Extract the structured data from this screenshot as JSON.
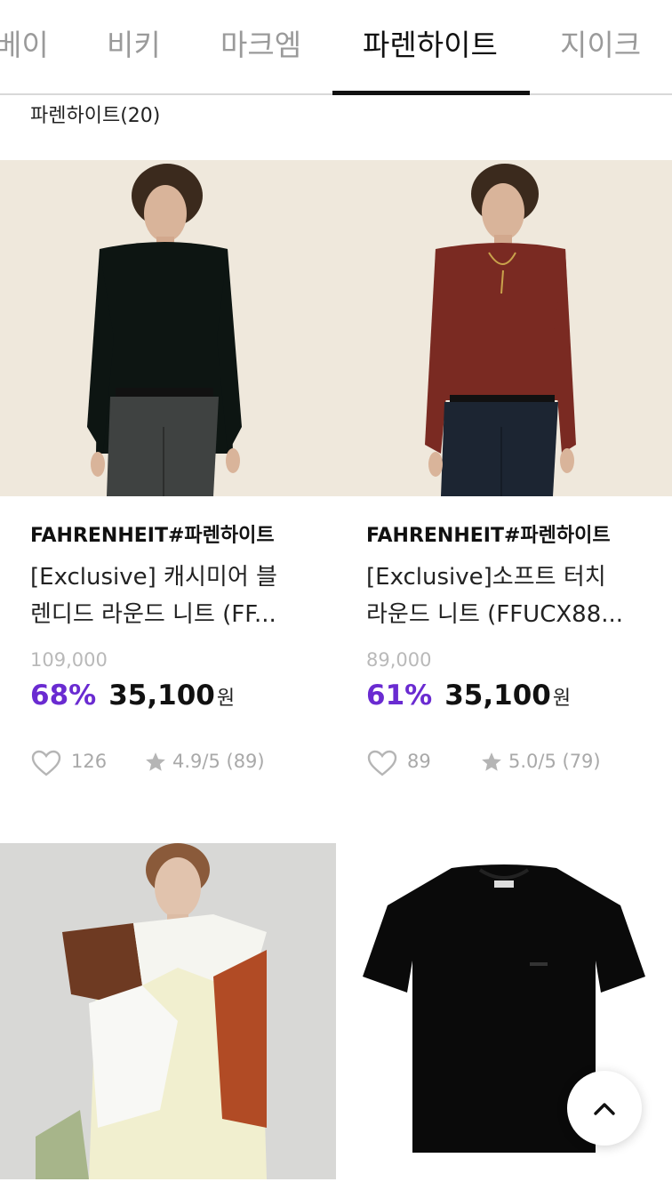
{
  "tabs": [
    {
      "label": "베이",
      "active": false
    },
    {
      "label": "비키",
      "active": false
    },
    {
      "label": "마크엠",
      "active": false
    },
    {
      "label": "파렌하이트",
      "active": true
    },
    {
      "label": "지이크",
      "active": false
    }
  ],
  "category_count_label": "파렌하이트(20)",
  "products": [
    {
      "brand": "FAHRENHEIT#파렌하이트",
      "name_line1": "[Exclusive] 캐시미어 블",
      "name_line2": "렌디드 라운드 니트 (FF...",
      "original_price": "109,000",
      "discount": "68%",
      "price": "35,100",
      "currency": "원",
      "likes": "126",
      "rating": "4.9/5 (89)",
      "image": "model-black-knit"
    },
    {
      "brand": "FAHRENHEIT#파렌하이트",
      "name_line1": "[Exclusive]소프트 터치",
      "name_line2": "라운드 니트 (FFUCX88...",
      "original_price": "89,000",
      "discount": "61%",
      "price": "35,100",
      "currency": "원",
      "likes": "89",
      "rating": "5.0/5 (79)",
      "image": "model-burgundy-knit"
    },
    {
      "image": "model-cream-knit-with-colorblock-scarf"
    },
    {
      "image": "black-tshirt"
    }
  ],
  "colors": {
    "accent": "#6a2bd1",
    "muted": "#a9a9a9",
    "text": "#111111"
  },
  "icons": {
    "like": "heart-outline-icon",
    "rating": "star-icon",
    "scroll_top": "chevron-up-icon"
  }
}
